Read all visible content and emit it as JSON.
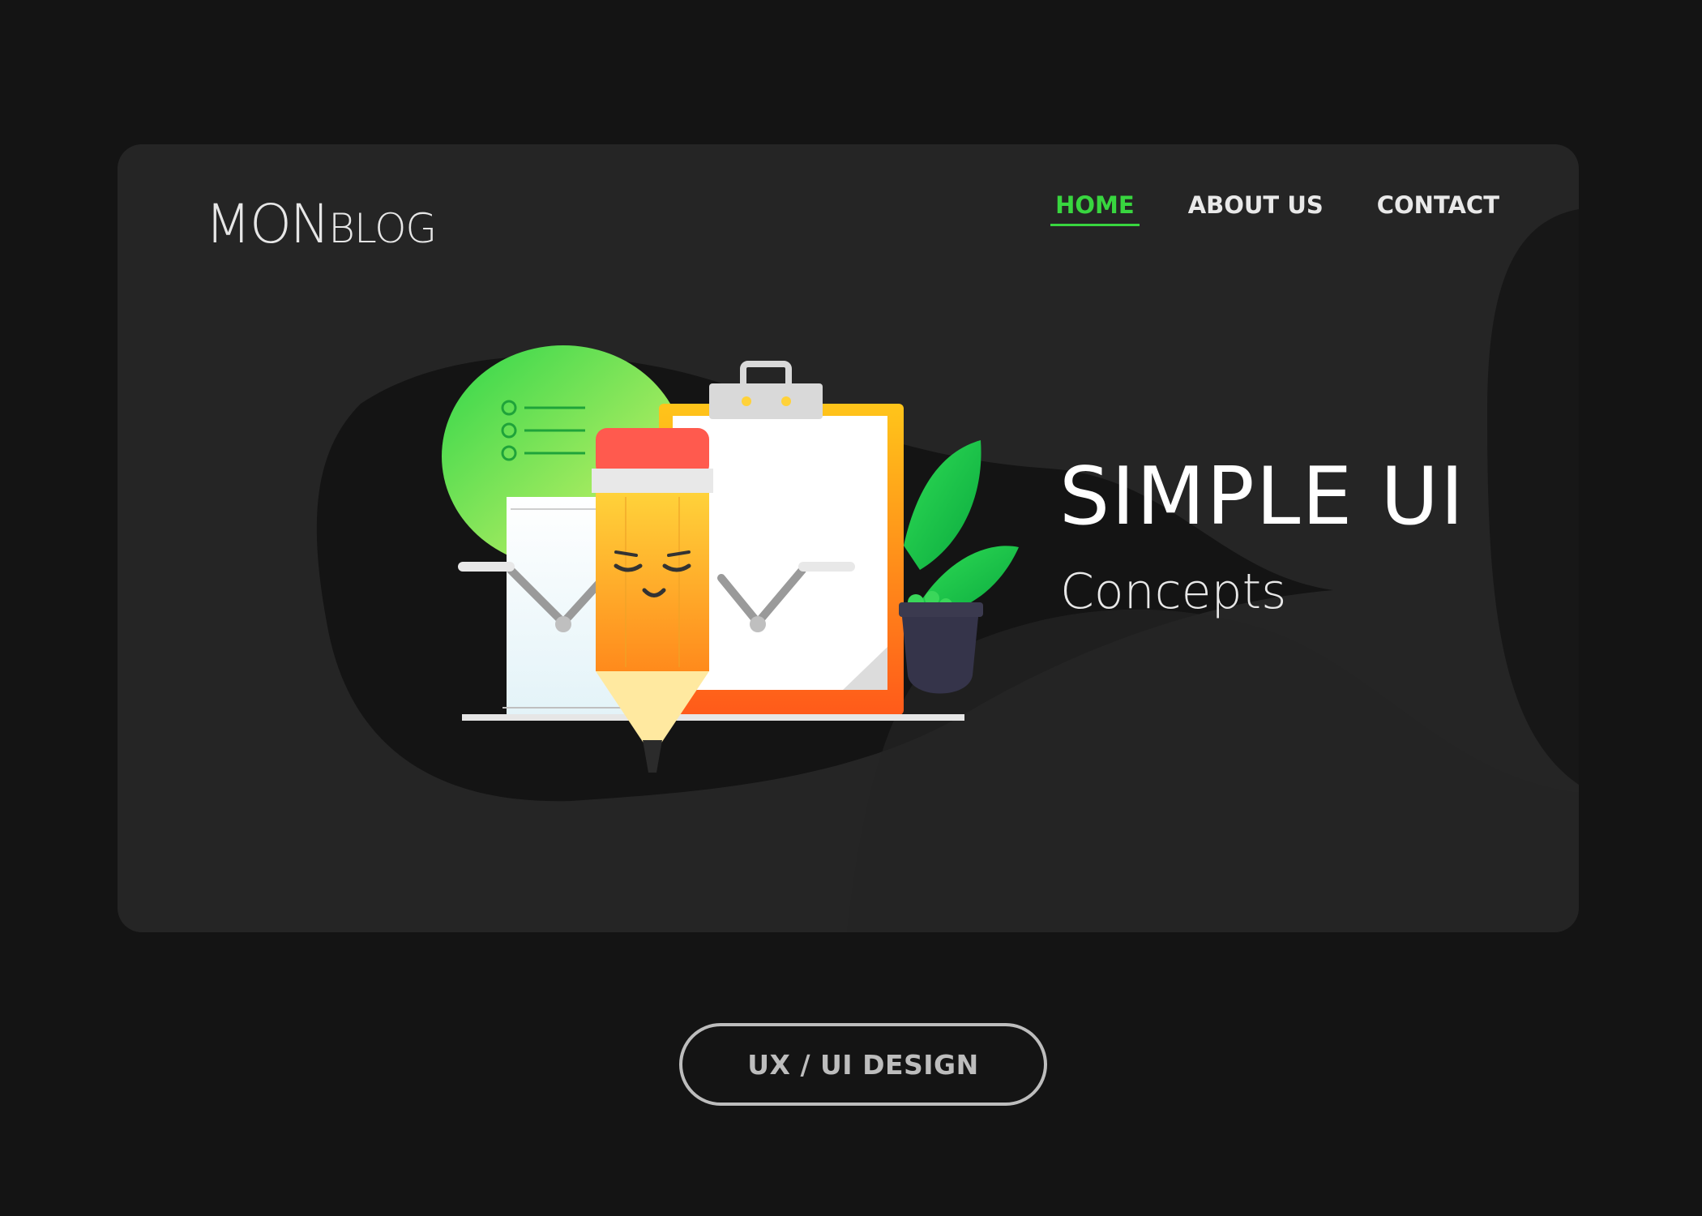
{
  "logo": {
    "part1": "MON",
    "part2": "BLOG"
  },
  "nav": {
    "items": [
      {
        "label": "HOME",
        "active": true
      },
      {
        "label": "ABOUT US",
        "active": false
      },
      {
        "label": "CONTACT",
        "active": false
      }
    ]
  },
  "hero": {
    "title": "SIMPLE UI",
    "subtitle": "Concepts"
  },
  "cta": {
    "label": "UX / UI DESIGN"
  },
  "colors": {
    "background": "#141414",
    "card": "#252525",
    "accent_green": "#38d63f",
    "text_light": "#e9e9e9"
  },
  "illustration": {
    "icons": [
      "speech-bubble-icon",
      "checklist-icon",
      "clipboard-icon",
      "pencil-character-icon",
      "plant-pot-icon",
      "paper-sheet-icon"
    ]
  }
}
